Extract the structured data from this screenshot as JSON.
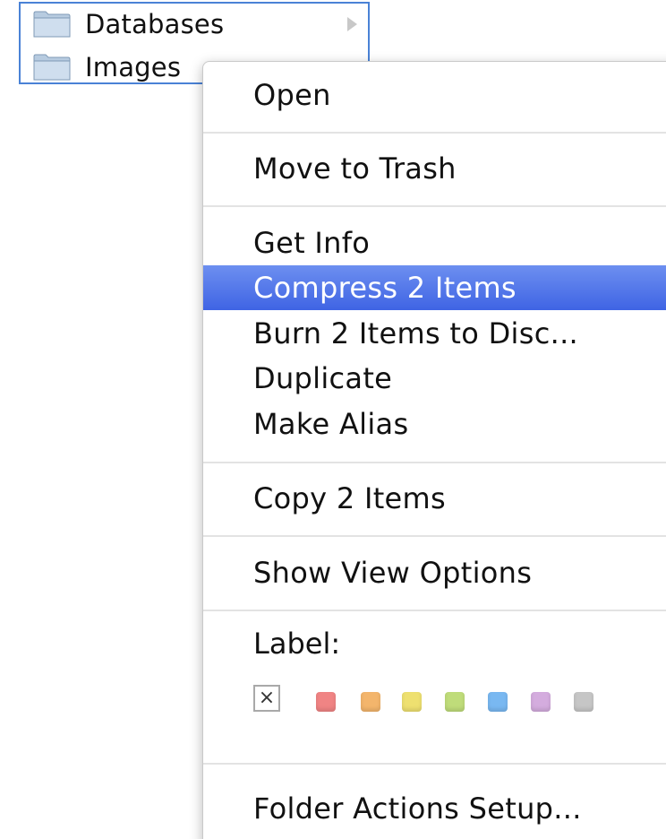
{
  "finder": {
    "rows": [
      {
        "name": "Databases"
      },
      {
        "name": "Images"
      }
    ],
    "selection_color": "#4a82d6"
  },
  "context_menu": {
    "items": [
      {
        "label": "Open"
      },
      {
        "label": "Move to Trash"
      },
      {
        "label": "Get Info"
      },
      {
        "label": "Compress 2 Items",
        "highlighted": true
      },
      {
        "label": "Burn 2 Items to Disc..."
      },
      {
        "label": "Duplicate"
      },
      {
        "label": "Make Alias"
      },
      {
        "label": "Copy 2 Items"
      },
      {
        "label": "Show View Options"
      },
      {
        "label": "Folder Actions Setup..."
      }
    ],
    "label_section": {
      "heading": "Label:",
      "none_glyph": "×",
      "colors": [
        {
          "name": "red",
          "hex": "#f08484"
        },
        {
          "name": "orange",
          "hex": "#f3b56c"
        },
        {
          "name": "yellow",
          "hex": "#eee070"
        },
        {
          "name": "green",
          "hex": "#bfdc7a"
        },
        {
          "name": "blue",
          "hex": "#79b8f1"
        },
        {
          "name": "purple",
          "hex": "#d4acde"
        },
        {
          "name": "gray",
          "hex": "#c6c6c6"
        }
      ]
    },
    "highlight_color": "#4a6fe6"
  }
}
